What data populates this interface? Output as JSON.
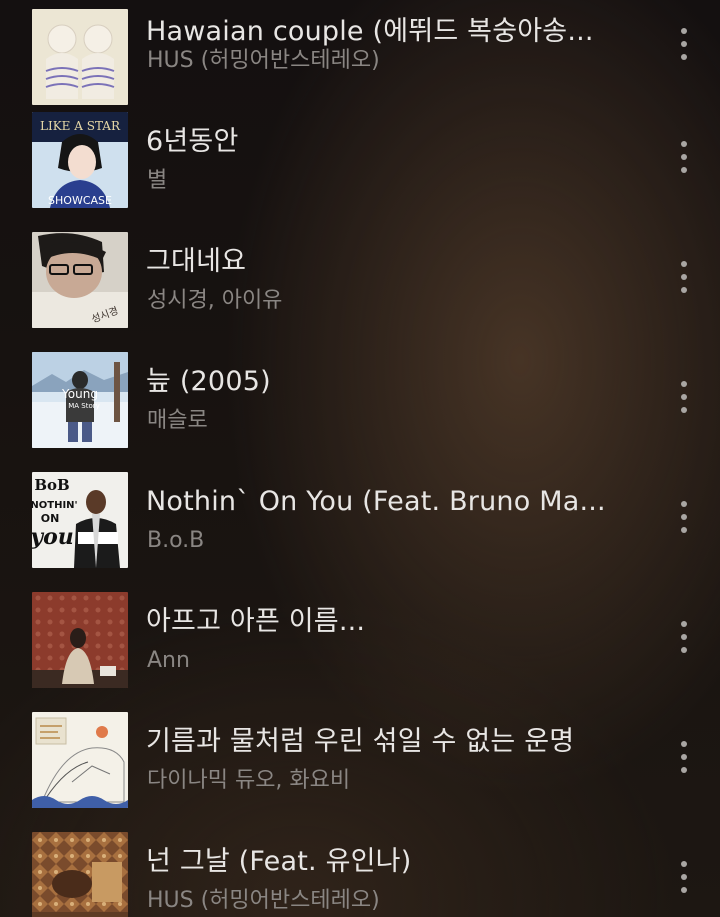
{
  "tracks": [
    {
      "title": "Hawaian couple (에뛰드 복숭아송...",
      "artist": "HUS (허밍어반스테레오)",
      "art_icon": "album-art-hawaian-couple"
    },
    {
      "title": "6년동안",
      "artist": "별",
      "art_icon": "album-art-showcase"
    },
    {
      "title": "그대네요",
      "artist": "성시경, 아이유",
      "art_icon": "album-art-sung-si-kyung"
    },
    {
      "title": "늪 (2005)",
      "artist": "매슬로",
      "art_icon": "album-art-young-ma-story"
    },
    {
      "title": "Nothin` On You (Feat. Bruno Ma...",
      "artist": "B.o.B",
      "art_icon": "album-art-nothin-on-you"
    },
    {
      "title": "아프고 아픈 이름...",
      "artist": "Ann",
      "art_icon": "album-art-ann"
    },
    {
      "title": "기름과 물처럼 우린 섞일 수 없는 운명",
      "artist": "다이나믹 듀오, 화요비",
      "art_icon": "album-art-dynamic-duo"
    },
    {
      "title": "넌 그날 (Feat. 유인나)",
      "artist": "HUS (허밍어반스테레오)",
      "art_icon": "album-art-hus"
    }
  ],
  "art_text": {
    "showcase_top": "LIKE A STAR",
    "showcase_bottom": "SHOWCASE",
    "young_1": "Young",
    "young_2": "MA Story",
    "bob_logo": "BoB",
    "bob_1": "NOTHIN'",
    "bob_2": "ON",
    "bob_3": "you",
    "sung_sig": "성시경"
  },
  "colors": {
    "title": "#e8e6e4",
    "artist": "#8a8683",
    "menu_dots": "#a9a6a3"
  }
}
